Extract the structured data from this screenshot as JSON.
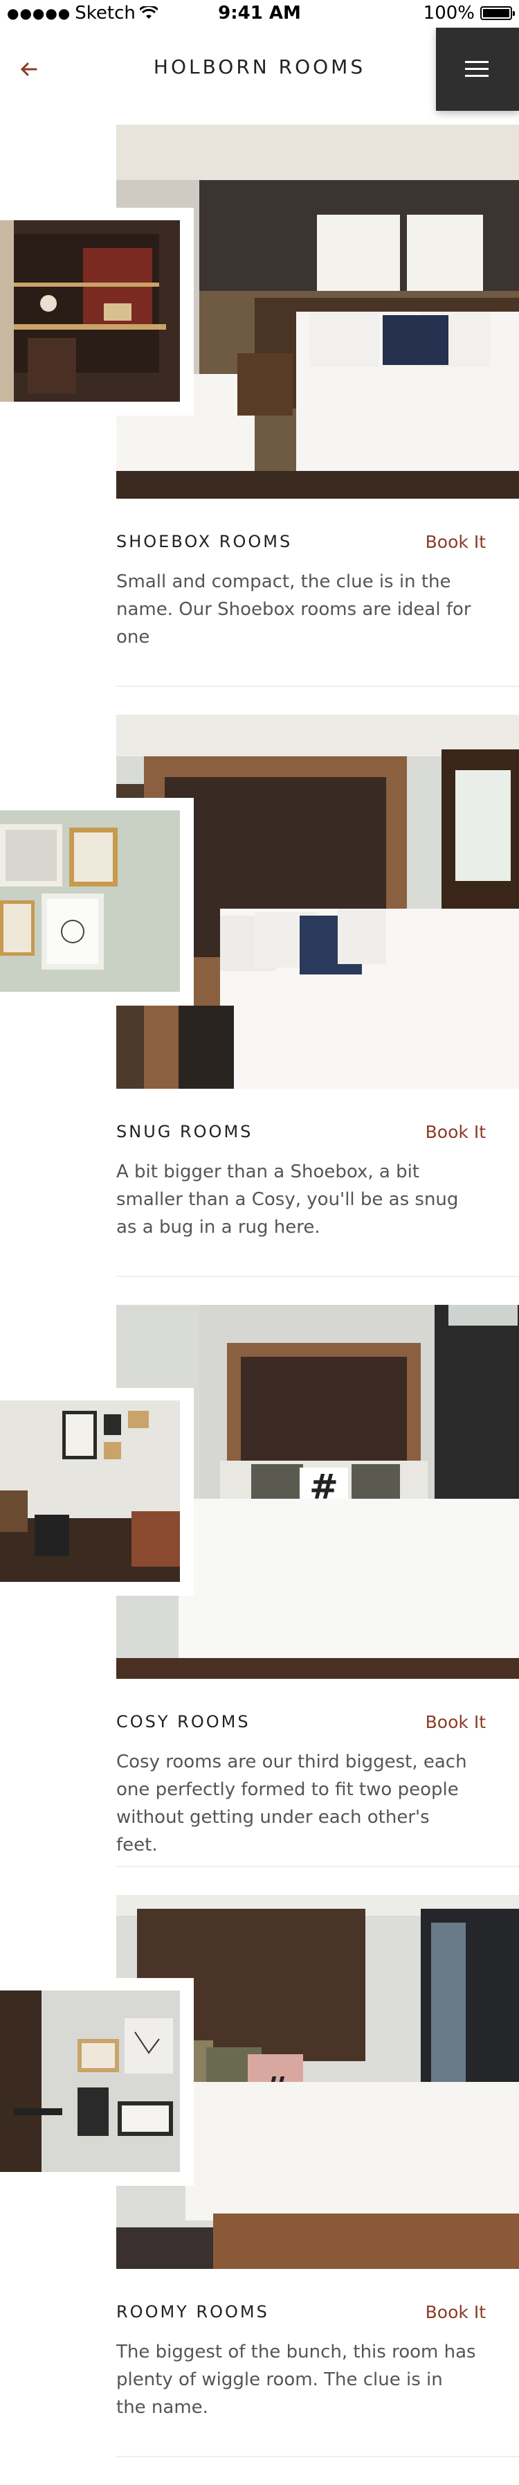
{
  "status_bar": {
    "carrier": "Sketch",
    "time": "9:41 AM",
    "battery": "100%"
  },
  "header": {
    "title": "HOLBORN ROOMS",
    "back_icon": "arrow-left-icon",
    "menu_icon": "hamburger-icon"
  },
  "rooms": [
    {
      "name": "SHOEBOX ROOMS",
      "book_label": "Book It",
      "description": "Small and compact, the clue is in the name. Our Shoebox rooms are ideal for one"
    },
    {
      "name": "SNUG ROOMS",
      "book_label": "Book It",
      "description": "A bit bigger than a Shoebox, a bit smaller than a Cosy, you'll be as snug as a bug in a rug here."
    },
    {
      "name": "COSY ROOMS",
      "book_label": "Book It",
      "description": "Cosy rooms are our third biggest, each one perfectly formed to fit two people without getting under each other's feet."
    },
    {
      "name": "ROOMY ROOMS",
      "book_label": "Book It",
      "description": "The biggest of the bunch, this room has plenty of wiggle room. The clue is in the name."
    }
  ],
  "colors": {
    "accent": "#8a3b26",
    "menu_bg": "#2f2f2f",
    "text": "#222222",
    "muted": "#555555"
  }
}
